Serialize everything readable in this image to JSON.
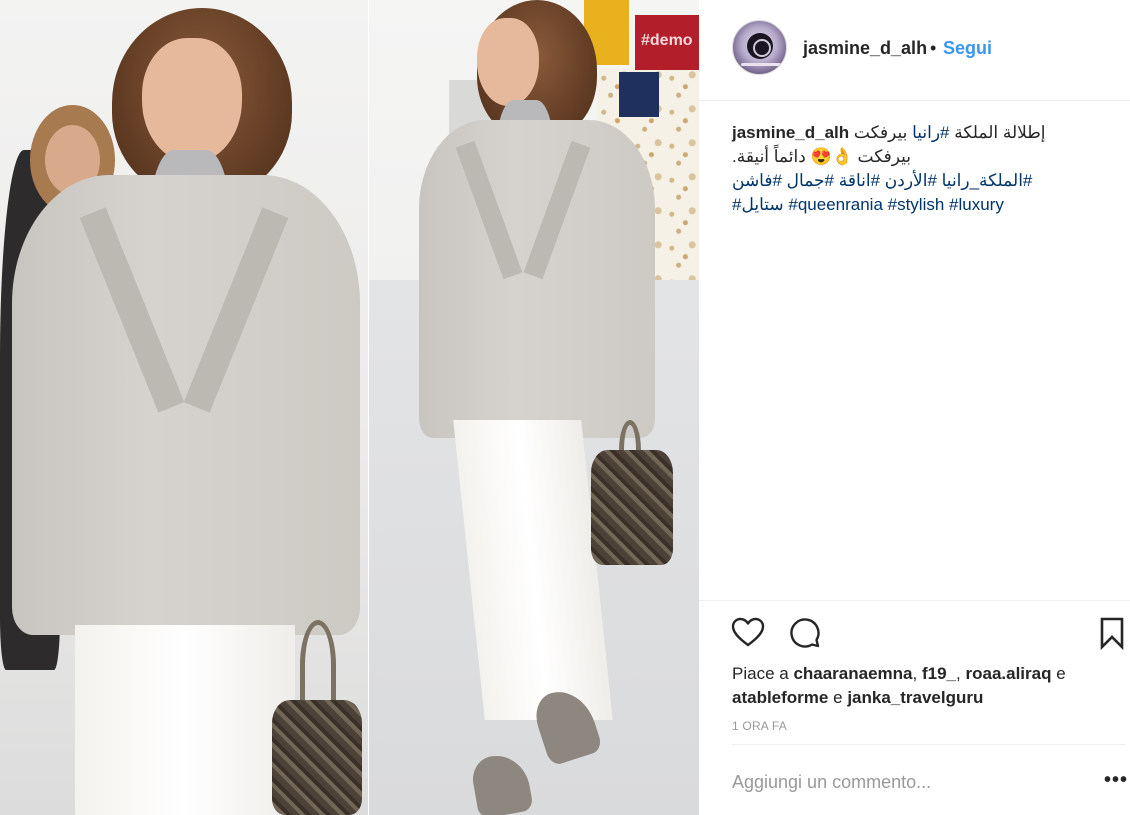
{
  "post": {
    "image_alt_icon": "photo",
    "background_sign": "#demo"
  },
  "header": {
    "username": "jasmine_d_alh",
    "separator": "•",
    "follow_label": "Segui"
  },
  "caption": {
    "username": "jasmine_d_alh",
    "line1_text": "إطلالة الملكة ",
    "line1_tag": "#رانيا",
    "line1_end": " بيرفكت",
    "line2": "بيرفكت 👌😍 دائماً أنيقة.",
    "line3": "#الملكة_رانيا #الأردن #اناقة #جمال   #فاشن",
    "line4_arabic": "#ستايل",
    "line4_tags": "#queenrania #stylish #luxury"
  },
  "actions": {
    "like_icon": "heart-icon",
    "comment_icon": "comment-icon",
    "save_icon": "bookmark-icon"
  },
  "likes": {
    "prefix": "Piace a",
    "user1": "chaaranaemna",
    "user2": "f19_",
    "user3": "roaa.aliraq",
    "conj1": "e",
    "user4": "atableforme",
    "conj2": "e",
    "user5": "janka_travelguru",
    "comma": ","
  },
  "timestamp": "1 ORA FA",
  "comment": {
    "placeholder": "Aggiungi un commento...",
    "more_label": "•••"
  }
}
